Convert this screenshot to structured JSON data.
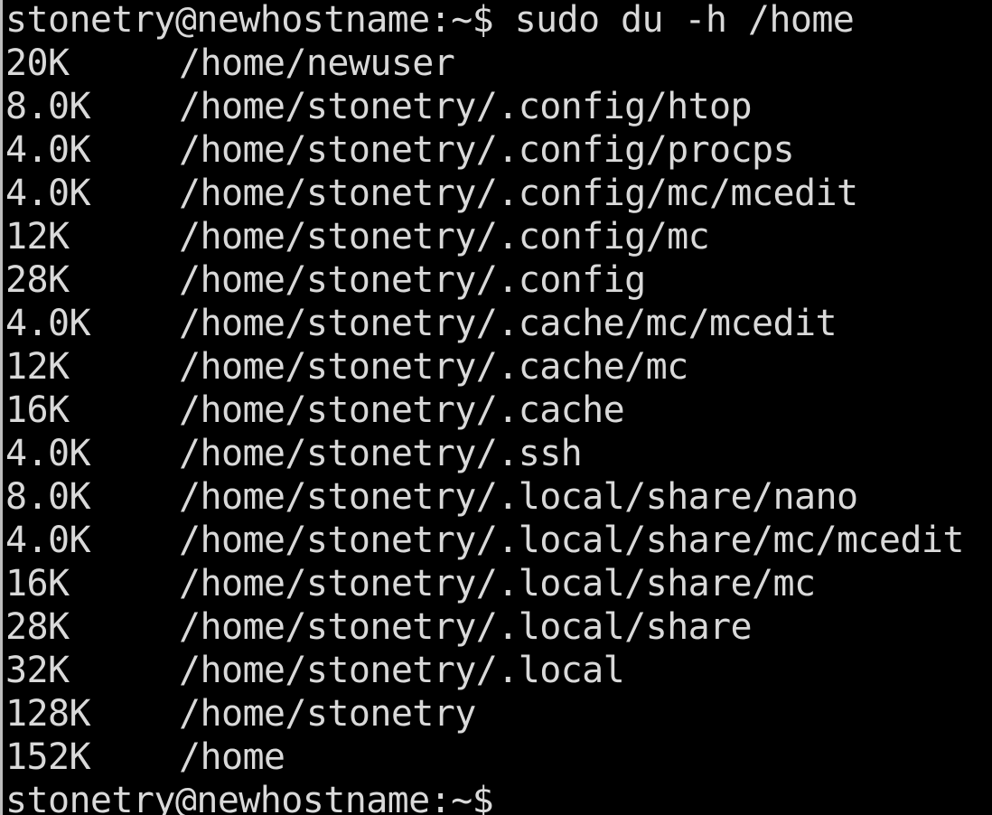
{
  "terminal": {
    "prompt": "stonetry@newhostname:~$",
    "command": "sudo du -h /home",
    "rows": [
      {
        "size": "20K",
        "path": "/home/newuser"
      },
      {
        "size": "8.0K",
        "path": "/home/stonetry/.config/htop"
      },
      {
        "size": "4.0K",
        "path": "/home/stonetry/.config/procps"
      },
      {
        "size": "4.0K",
        "path": "/home/stonetry/.config/mc/mcedit"
      },
      {
        "size": "12K",
        "path": "/home/stonetry/.config/mc"
      },
      {
        "size": "28K",
        "path": "/home/stonetry/.config"
      },
      {
        "size": "4.0K",
        "path": "/home/stonetry/.cache/mc/mcedit"
      },
      {
        "size": "12K",
        "path": "/home/stonetry/.cache/mc"
      },
      {
        "size": "16K",
        "path": "/home/stonetry/.cache"
      },
      {
        "size": "4.0K",
        "path": "/home/stonetry/.ssh"
      },
      {
        "size": "8.0K",
        "path": "/home/stonetry/.local/share/nano"
      },
      {
        "size": "4.0K",
        "path": "/home/stonetry/.local/share/mc/mcedit"
      },
      {
        "size": "16K",
        "path": "/home/stonetry/.local/share/mc"
      },
      {
        "size": "28K",
        "path": "/home/stonetry/.local/share"
      },
      {
        "size": "32K",
        "path": "/home/stonetry/.local"
      },
      {
        "size": "128K",
        "path": "/home/stonetry"
      },
      {
        "size": "152K",
        "path": "/home"
      }
    ],
    "final_prompt": "stonetry@newhostname:~$"
  }
}
